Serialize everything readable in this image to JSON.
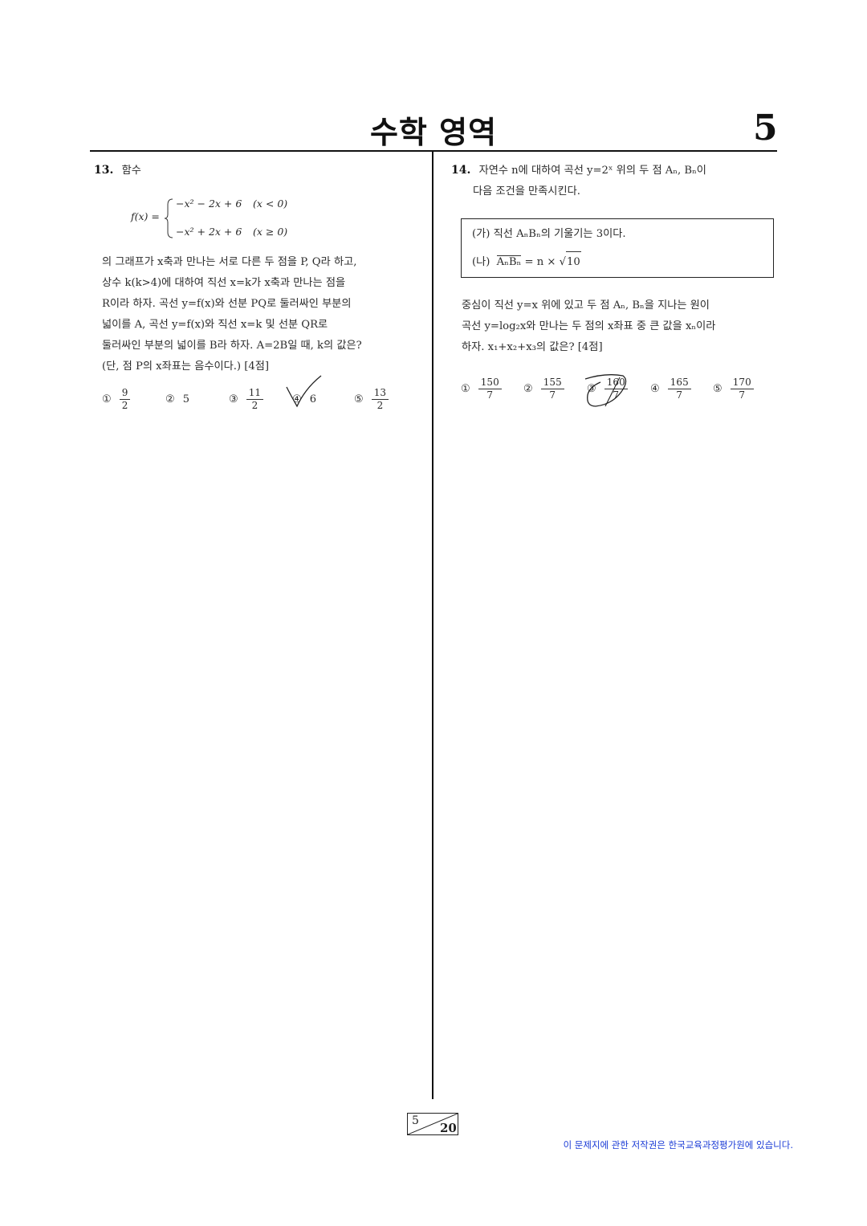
{
  "header": {
    "title": "수학 영역",
    "page_number": "5"
  },
  "q13": {
    "number": "13.",
    "intro": "함수",
    "func_lhs": "f(x) =",
    "case1_expr": "−x² − 2x + 6",
    "case1_cond": "(x < 0)",
    "case2_expr": "−x² + 2x + 6",
    "case2_cond": "(x ≥ 0)",
    "body_lines": [
      "의 그래프가 x축과 만나는 서로 다른 두 점을 P, Q라 하고,",
      "상수 k(k>4)에 대하여 직선 x=k가 x축과 만나는 점을",
      "R이라 하자. 곡선 y=f(x)와 선분 PQ로 둘러싸인 부분의",
      "넓이를 A, 곡선 y=f(x)와 직선 x=k 및 선분 QR로",
      "둘러싸인 부분의 넓이를 B라 하자. A=2B일 때, k의 값은?",
      "(단, 점 P의 x좌표는 음수이다.) [4점]"
    ],
    "choices": [
      {
        "mark": "①",
        "num": "9",
        "den": "2"
      },
      {
        "mark": "②",
        "value": "5"
      },
      {
        "mark": "③",
        "num": "11",
        "den": "2"
      },
      {
        "mark": "④",
        "value": "6"
      },
      {
        "mark": "⑤",
        "num": "13",
        "den": "2"
      }
    ]
  },
  "q14": {
    "number": "14.",
    "intro_lines": [
      "자연수 n에 대하여 곡선 y=2ˣ 위의 두 점 Aₙ, Bₙ이",
      "다음 조건을 만족시킨다."
    ],
    "cond_a": "(가) 직선 AₙBₙ의 기울기는 3이다.",
    "cond_b_label": "(나)",
    "cond_b_seg": "AₙBₙ",
    "cond_b_mid": " = n × ",
    "cond_b_rad": "10",
    "body_lines": [
      "중심이 직선 y=x 위에 있고 두 점 Aₙ, Bₙ을 지나는 원이",
      "곡선 y=log₂x와 만나는 두 점의 x좌표 중 큰 값을 xₙ이라",
      "하자. x₁+x₂+x₃의 값은? [4점]"
    ],
    "choices": [
      {
        "mark": "①",
        "num": "150",
        "den": "7"
      },
      {
        "mark": "②",
        "num": "155",
        "den": "7"
      },
      {
        "mark": "③",
        "num": "160",
        "den": "7"
      },
      {
        "mark": "④",
        "num": "165",
        "den": "7"
      },
      {
        "mark": "⑤",
        "num": "170",
        "den": "7"
      }
    ]
  },
  "footer": {
    "page_current": "5",
    "page_total": "20",
    "copyright": "이 문제지에 관한 저작권은 한국교육과정평가원에 있습니다."
  }
}
